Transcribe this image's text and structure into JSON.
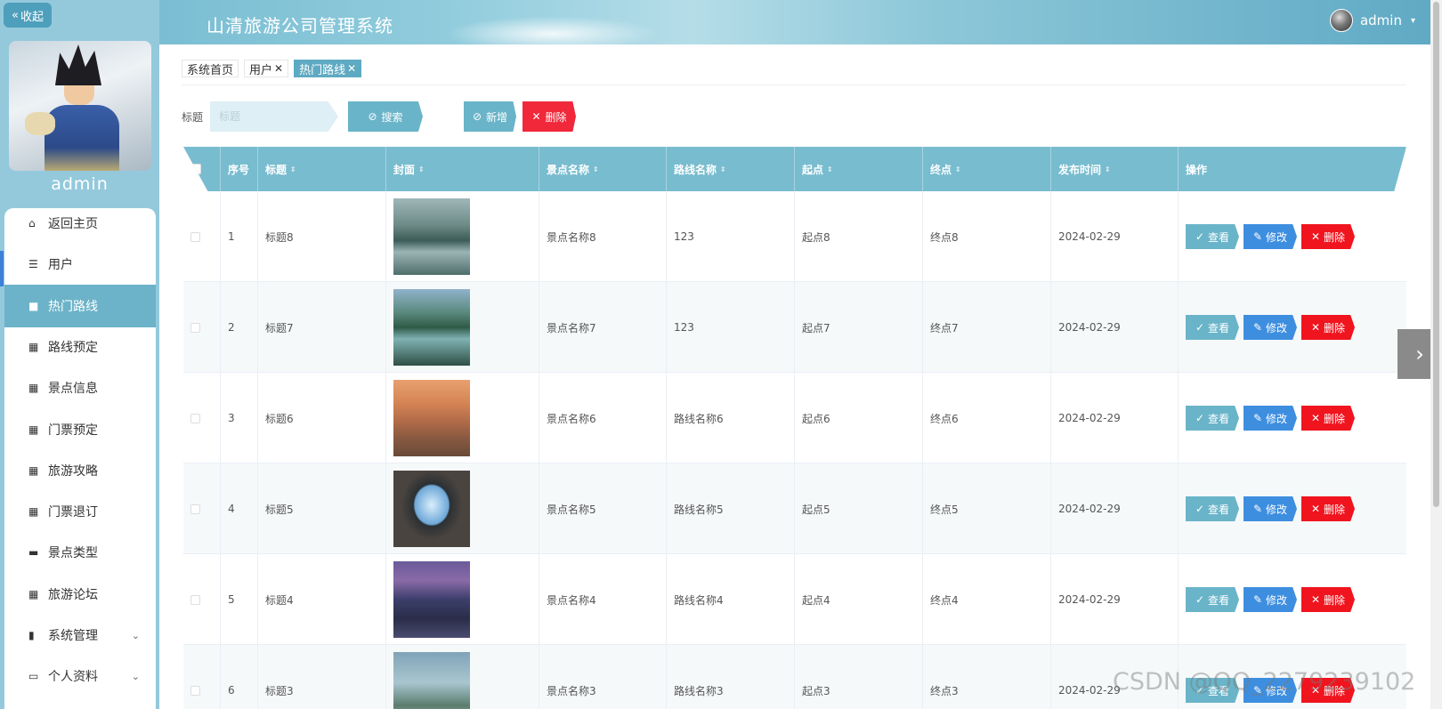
{
  "header": {
    "title": "山清旅游公司管理系统",
    "username": "admin"
  },
  "sidebar": {
    "collapse_label": "收起",
    "username": "admin",
    "items": [
      {
        "label": "返回主页",
        "icon": "home-icon"
      },
      {
        "label": "用户",
        "icon": "sliders-icon"
      },
      {
        "label": "热门路线",
        "icon": "bag-icon",
        "active": true
      },
      {
        "label": "路线预定",
        "icon": "grid-icon"
      },
      {
        "label": "景点信息",
        "icon": "grid-icon"
      },
      {
        "label": "门票预定",
        "icon": "grid-icon"
      },
      {
        "label": "旅游攻略",
        "icon": "grid-icon"
      },
      {
        "label": "门票退订",
        "icon": "grid-icon"
      },
      {
        "label": "景点类型",
        "icon": "briefcase-icon"
      },
      {
        "label": "旅游论坛",
        "icon": "apps-icon"
      },
      {
        "label": "系统管理",
        "icon": "clipboard-icon",
        "expandable": true
      },
      {
        "label": "个人资料",
        "icon": "id-card-icon",
        "expandable": true
      }
    ]
  },
  "tabs": [
    {
      "label": "系统首页",
      "closable": false,
      "active": false
    },
    {
      "label": "用户",
      "closable": true,
      "active": false
    },
    {
      "label": "热门路线",
      "closable": true,
      "active": true
    }
  ],
  "search": {
    "label": "标题",
    "placeholder": "标题",
    "search_button": "搜索",
    "add_button": "新增",
    "delete_button": "删除"
  },
  "table": {
    "columns": [
      "序号",
      "标题",
      "封面",
      "景点名称",
      "路线名称",
      "起点",
      "终点",
      "发布时间",
      "操作"
    ],
    "actions": {
      "view": "查看",
      "edit": "修改",
      "delete": "删除"
    },
    "rows": [
      {
        "index": "1",
        "title": "标题8",
        "spot": "景点名称8",
        "route": "123",
        "start": "起点8",
        "end": "终点8",
        "date": "2024-02-29",
        "cover": "lake-mist"
      },
      {
        "index": "2",
        "title": "标题7",
        "spot": "景点名称7",
        "route": "123",
        "start": "起点7",
        "end": "终点7",
        "date": "2024-02-29",
        "cover": "lake-forest"
      },
      {
        "index": "3",
        "title": "标题6",
        "spot": "景点名称6",
        "route": "路线名称6",
        "start": "起点6",
        "end": "终点6",
        "date": "2024-02-29",
        "cover": "sunset-house"
      },
      {
        "index": "4",
        "title": "标题5",
        "spot": "景点名称5",
        "route": "路线名称5",
        "start": "起点5",
        "end": "终点5",
        "date": "2024-02-29",
        "cover": "cave-arch"
      },
      {
        "index": "5",
        "title": "标题4",
        "spot": "景点名称4",
        "route": "路线名称4",
        "start": "起点4",
        "end": "终点4",
        "date": "2024-02-29",
        "cover": "mountain-night"
      },
      {
        "index": "6",
        "title": "标题3",
        "spot": "景点名称3",
        "route": "路线名称3",
        "start": "起点3",
        "end": "终点3",
        "date": "2024-02-29",
        "cover": "river-valley"
      }
    ]
  },
  "watermark": "CSDN @QQ_2279239102",
  "colors": {
    "primary": "#6ab4c9",
    "edit": "#3e8ee0",
    "danger": "#f0141e",
    "sidebar": "#94c9dc"
  }
}
